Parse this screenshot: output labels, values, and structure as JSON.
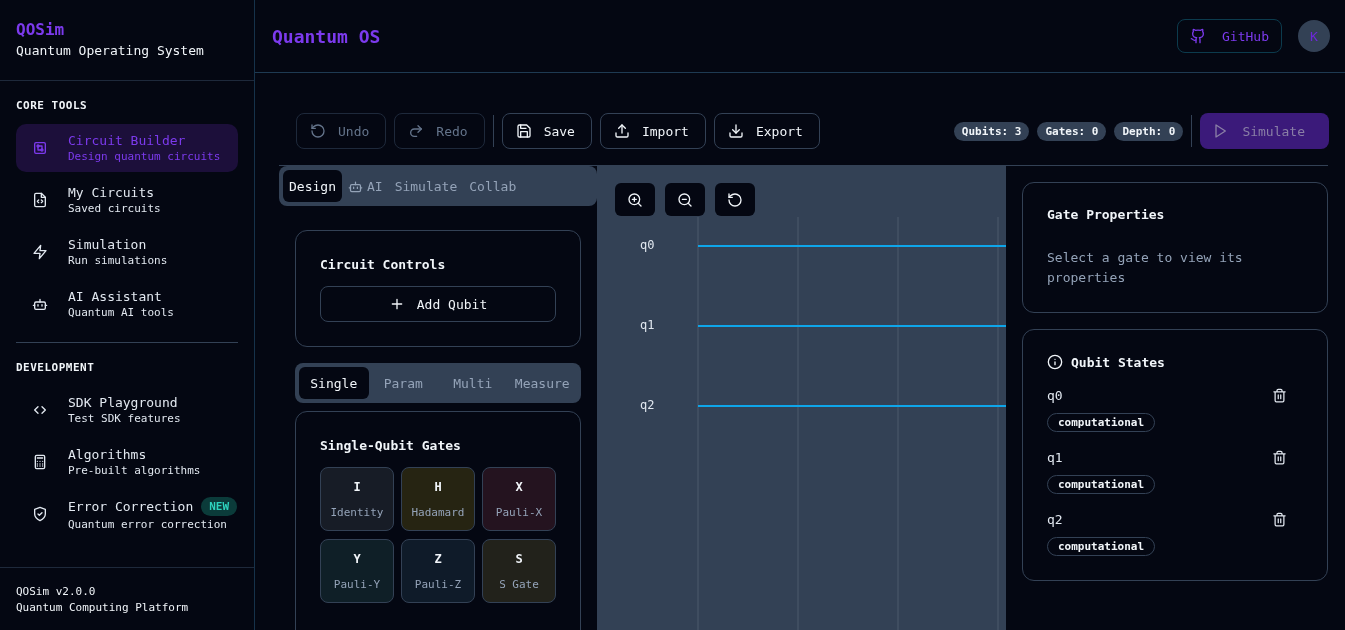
{
  "sidebar": {
    "brand": {
      "title": "QOSim",
      "subtitle": "Quantum Operating System"
    },
    "sections": [
      {
        "heading": "CORE TOOLS",
        "items": [
          {
            "label": "Circuit Builder",
            "description": "Design quantum circuits",
            "selected": true
          },
          {
            "label": "My Circuits",
            "description": "Saved circuits",
            "selected": false
          },
          {
            "label": "Simulation",
            "description": "Run simulations",
            "selected": false
          },
          {
            "label": "AI Assistant",
            "description": "Quantum AI tools",
            "selected": false
          }
        ]
      },
      {
        "heading": "DEVELOPMENT",
        "items": [
          {
            "label": "SDK Playground",
            "description": "Test SDK features",
            "selected": false
          },
          {
            "label": "Algorithms",
            "description": "Pre-built algorithms",
            "selected": false
          },
          {
            "label": "Error Correction",
            "description": "Quantum error correction",
            "selected": false,
            "badge": "NEW"
          }
        ]
      }
    ],
    "footer": {
      "version": "QOSim v2.0.0",
      "tagline": "Quantum Computing Platform"
    }
  },
  "header": {
    "title": "Quantum OS",
    "github": "GitHub",
    "avatar": "K"
  },
  "toolbar": {
    "buttons": [
      {
        "label": "Undo",
        "disabled": true
      },
      {
        "label": "Redo",
        "disabled": true
      },
      {
        "label": "Save",
        "disabled": false
      },
      {
        "label": "Import",
        "disabled": false
      },
      {
        "label": "Export",
        "disabled": false
      }
    ],
    "stats": [
      "Qubits: 3",
      "Gates: 0",
      "Depth: 0"
    ],
    "simulate": {
      "label": "Simulate",
      "disabled": true
    }
  },
  "panel_tabs": [
    {
      "label": "Design",
      "selected": true
    },
    {
      "label": "AI",
      "selected": false
    },
    {
      "label": "Simulate",
      "selected": false
    },
    {
      "label": "Collab",
      "selected": false
    }
  ],
  "circuit_controls": {
    "title": "Circuit Controls",
    "button": "Add Qubit"
  },
  "gate_tabs": [
    {
      "label": "Single",
      "selected": true
    },
    {
      "label": "Param",
      "selected": false
    },
    {
      "label": "Multi",
      "selected": false
    },
    {
      "label": "Measure",
      "selected": false
    }
  ],
  "gates": {
    "title": "Single-Qubit Gates",
    "items": [
      {
        "symbol": "I",
        "name": "Identity",
        "color": "#171c26"
      },
      {
        "symbol": "H",
        "name": "Hadamard",
        "color": "#262412"
      },
      {
        "symbol": "X",
        "name": "Pauli-X",
        "color": "#24131f"
      },
      {
        "symbol": "Y",
        "name": "Pauli-Y",
        "color": "#0f1f27"
      },
      {
        "symbol": "Z",
        "name": "Pauli-Z",
        "color": "#0f1b29"
      },
      {
        "symbol": "S",
        "name": "S Gate",
        "color": "#22221b"
      }
    ]
  },
  "canvas": {
    "qubits": [
      "q0",
      "q1",
      "q2"
    ]
  },
  "gate_properties": {
    "title": "Gate Properties",
    "hint": "Select a gate to view its properties"
  },
  "qubit_states": {
    "title": "Qubit States",
    "items": [
      {
        "name": "q0",
        "basis": "computational"
      },
      {
        "name": "q1",
        "basis": "computational"
      },
      {
        "name": "q2",
        "basis": "computational"
      }
    ]
  }
}
